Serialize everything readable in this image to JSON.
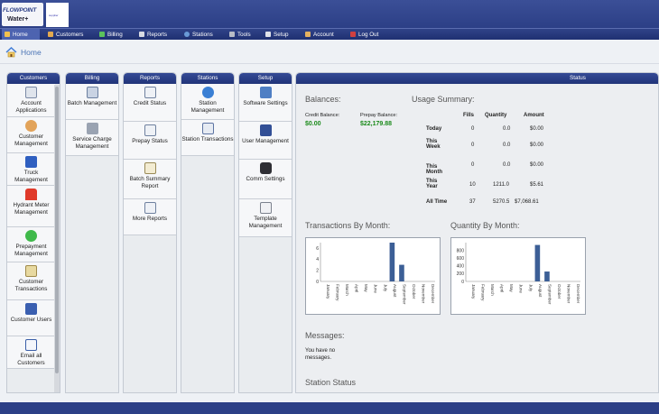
{
  "brand": {
    "logo_line1": "FLOWPOINT",
    "logo_line2": "Water+",
    "client_logo_text": "supplier"
  },
  "nav": {
    "items": [
      {
        "label": "Home",
        "icon": "home-icon"
      },
      {
        "label": "Customers",
        "icon": "customers-icon"
      },
      {
        "label": "Billing",
        "icon": "billing-icon"
      },
      {
        "label": "Reports",
        "icon": "reports-icon"
      },
      {
        "label": "Stations",
        "icon": "stations-icon"
      },
      {
        "label": "Tools",
        "icon": "tools-icon"
      },
      {
        "label": "Setup",
        "icon": "setup-icon"
      },
      {
        "label": "Account",
        "icon": "account-icon"
      },
      {
        "label": "Log Out",
        "icon": "logout-icon"
      }
    ]
  },
  "breadcrumb": {
    "label": "Home"
  },
  "panels": {
    "customers": {
      "title": "Customers",
      "items": [
        {
          "label": "Account Applications",
          "icon": "account-applications-icon"
        },
        {
          "label": "Customer Management",
          "icon": "customer-management-icon"
        },
        {
          "label": "Truck Management",
          "icon": "truck-icon"
        },
        {
          "label": "Hydrant Meter Management",
          "icon": "hydrant-icon"
        },
        {
          "label": "Prepayment Management",
          "icon": "dollar-icon"
        },
        {
          "label": "Customer Transactions",
          "icon": "transactions-icon"
        },
        {
          "label": "Customer Users",
          "icon": "users-icon"
        },
        {
          "label": "Email all Customers",
          "icon": "email-icon"
        }
      ]
    },
    "billing": {
      "title": "Billing",
      "items": [
        {
          "label": "Batch Management",
          "icon": "batch-icon"
        },
        {
          "label": "Service Charge Management",
          "icon": "service-charge-icon"
        }
      ]
    },
    "reports": {
      "title": "Reports",
      "items": [
        {
          "label": "Credit Status",
          "icon": "report-icon"
        },
        {
          "label": "Prepay Status",
          "icon": "report-icon"
        },
        {
          "label": "Batch Summary Report",
          "icon": "report-icon"
        },
        {
          "label": "More Reports",
          "icon": "report-icon"
        }
      ]
    },
    "stations": {
      "title": "Stations",
      "items": [
        {
          "label": "Station Management",
          "icon": "station-icon"
        },
        {
          "label": "Station Transactions",
          "icon": "station-transactions-icon"
        }
      ]
    },
    "setup": {
      "title": "Setup",
      "items": [
        {
          "label": "Software Settings",
          "icon": "software-settings-icon"
        },
        {
          "label": "User Management",
          "icon": "user-management-icon"
        },
        {
          "label": "Comm Settings",
          "icon": "comm-icon"
        },
        {
          "label": "Template Management",
          "icon": "template-icon"
        }
      ]
    }
  },
  "status": {
    "title": "Status",
    "balances": {
      "title": "Balances:",
      "credit_label": "Credit Balance:",
      "credit_value": "$0.00",
      "prepay_label": "Prepay Balance:",
      "prepay_value": "$22,179.88"
    },
    "usage": {
      "title": "Usage Summary:",
      "headers": [
        "Fills",
        "Quantity",
        "Amount"
      ],
      "rows": [
        {
          "label": "Today",
          "fills": "0",
          "quantity": "0.0",
          "amount": "$0.00"
        },
        {
          "label": "This Week",
          "fills": "0",
          "quantity": "0.0",
          "amount": "$0.00"
        },
        {
          "label": "This Month",
          "fills": "0",
          "quantity": "0.0",
          "amount": "$0.00"
        },
        {
          "label": "This Year",
          "fills": "10",
          "quantity": "1211.0",
          "amount": "$5.61"
        },
        {
          "label": "All Time",
          "fills": "37",
          "quantity": "5270.5",
          "amount": "$7,068.61"
        }
      ]
    },
    "transactions_title": "Transactions By Month:",
    "quantity_title": "Quantity By Month:",
    "messages_title": "Messages:",
    "messages_text": "You have no messages.",
    "station_status_title": "Station Status"
  },
  "chart_data": [
    {
      "type": "bar",
      "categories": [
        "January",
        "February",
        "March",
        "April",
        "May",
        "June",
        "July",
        "August",
        "September",
        "October",
        "November",
        "December"
      ],
      "values": [
        0,
        0,
        0,
        0,
        0,
        0,
        0,
        7,
        3,
        0,
        0,
        0
      ],
      "ylim": [
        0,
        7
      ],
      "yticks": [
        0,
        2,
        4,
        6
      ],
      "color": "#3c5f96"
    },
    {
      "type": "bar",
      "categories": [
        "January",
        "February",
        "March",
        "April",
        "May",
        "June",
        "July",
        "August",
        "September",
        "October",
        "November",
        "December"
      ],
      "values": [
        0,
        0,
        0,
        0,
        0,
        0,
        0,
        940,
        255,
        0,
        0,
        0
      ],
      "ylim": [
        0,
        1000
      ],
      "yticks": [
        0,
        200,
        400,
        600,
        800
      ],
      "color": "#3c5f96"
    }
  ]
}
